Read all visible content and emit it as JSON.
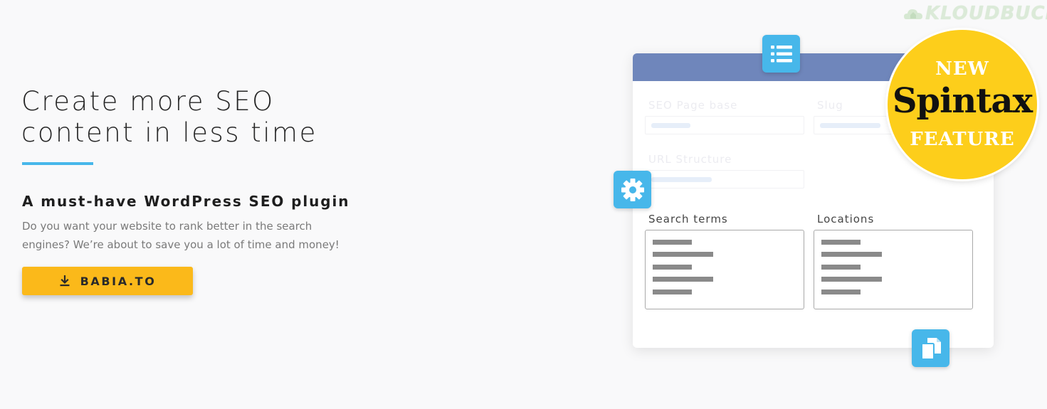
{
  "watermark": {
    "text": "KLOUDBUCKET"
  },
  "hero": {
    "title_line1": "Create more SEO",
    "title_line2": "content in less time",
    "subtitle": "A must-have WordPress SEO plugin",
    "desc_line1": "Do you want your website to rank better in the search",
    "desc_line2": "engines? We’re about to save you a lot of time and money!",
    "cta_label": "BABIA.TO"
  },
  "mockup": {
    "labels": {
      "seo_page_base": "SEO Page base",
      "slug": "Slug",
      "url_structure": "URL Structure",
      "search_terms": "Search terms",
      "locations": "Locations"
    }
  },
  "badge": {
    "top": "NEW",
    "middle": "Spintax",
    "bottom": "FEATURE"
  },
  "colors": {
    "accent_blue": "#47b7ea",
    "panel_header": "#6f86bb",
    "cta_yellow": "#fbb91a",
    "badge_yellow": "#fdce1b"
  },
  "icons": {
    "cta": "download-icon",
    "list": "list-icon",
    "gear": "gear-icon",
    "copy": "copy-icon"
  }
}
